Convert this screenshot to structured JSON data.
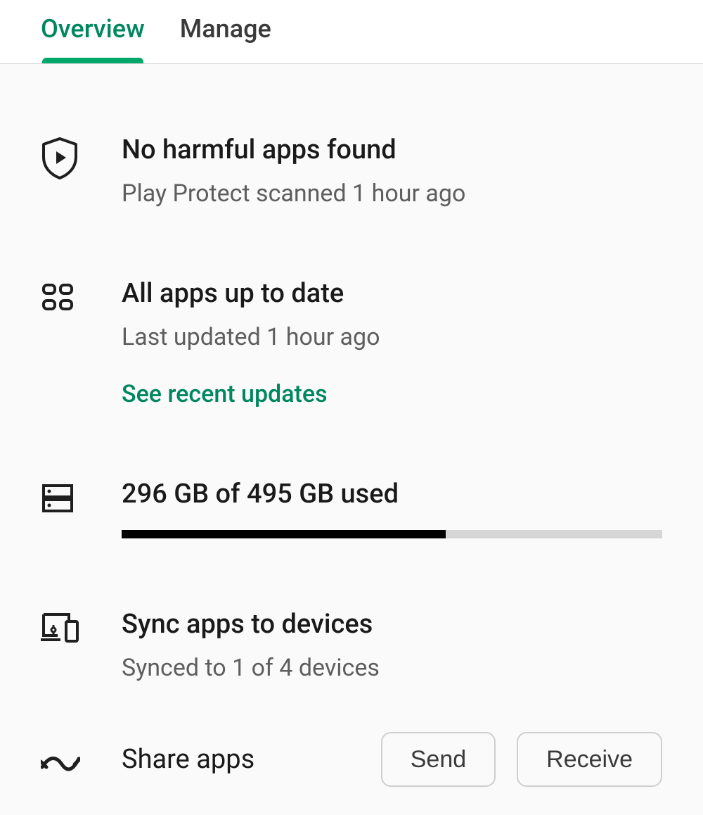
{
  "tabs": {
    "overview": "Overview",
    "manage": "Manage"
  },
  "protect": {
    "title": "No harmful apps found",
    "subtitle": "Play Protect scanned 1 hour ago"
  },
  "updates": {
    "title": "All apps up to date",
    "subtitle": "Last updated 1 hour ago",
    "link": "See recent updates"
  },
  "storage": {
    "title": "296 GB of 495 GB used",
    "percent": 60
  },
  "sync": {
    "title": "Sync apps to devices",
    "subtitle": "Synced to 1 of 4 devices"
  },
  "share": {
    "title": "Share apps",
    "send": "Send",
    "receive": "Receive"
  }
}
